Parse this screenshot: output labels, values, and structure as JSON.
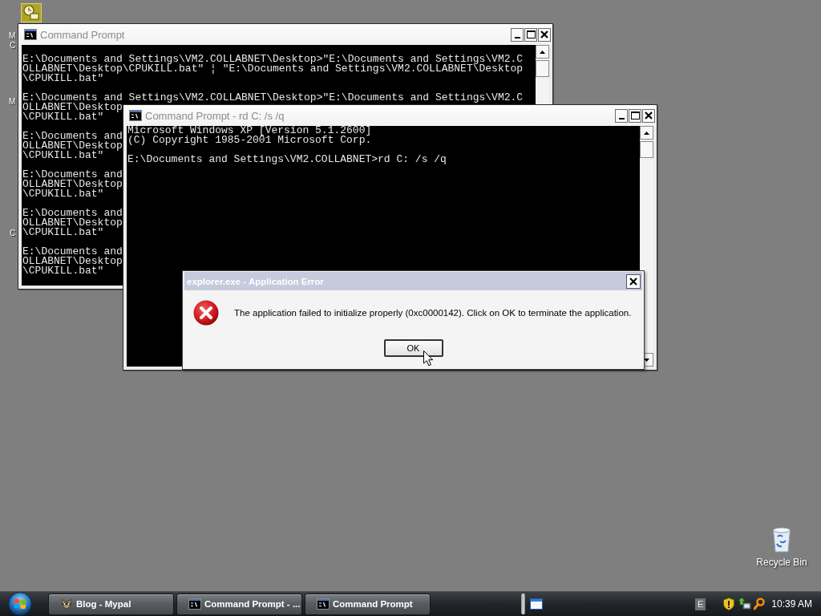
{
  "desktop": {
    "icon_label_fragments": [
      "M",
      "C",
      "M",
      "C"
    ],
    "recycle_bin": {
      "label": "Recycle Bin"
    }
  },
  "windows": [
    {
      "title": "Command Prompt",
      "active": false,
      "blocks": [
        [
          "E:\\Documents and Settings\\VM2.COLLABNET\\Desktop>\"E:\\Documents and Settings\\VM2.C",
          "OLLABNET\\Desktop\\CPUKILL.bat\" ¦ \"E:\\Documents and Settings\\VM2.COLLABNET\\Desktop",
          "\\CPUKILL.bat\""
        ],
        [
          "E:\\Documents and Settings\\VM2.COLLABNET\\Desktop>\"E:\\Documents and Settings\\VM2.C",
          "OLLABNET\\Desktop",
          "\\CPUKILL.bat\""
        ],
        [
          "E:\\Documents and",
          "OLLABNET\\Desktop",
          "\\CPUKILL.bat\""
        ],
        [
          "E:\\Documents and",
          "OLLABNET\\Desktop",
          "\\CPUKILL.bat\""
        ],
        [
          "E:\\Documents and",
          "OLLABNET\\Desktop",
          "\\CPUKILL.bat\""
        ],
        [
          "E:\\Documents and",
          "OLLABNET\\Desktop",
          "\\CPUKILL.bat\""
        ]
      ]
    },
    {
      "title": "Command Prompt - rd C: /s /q",
      "active": false,
      "blocks": [
        [
          "Microsoft Windows XP [Version 5.1.2600]",
          "(C) Copyright 1985-2001 Microsoft Corp."
        ],
        [
          "E:\\Documents and Settings\\VM2.COLLABNET>rd C: /s /q"
        ]
      ]
    }
  ],
  "dialog": {
    "title": "explorer.exe - Application Error",
    "message": "The application failed to initialize properly (0xc0000142). Click on OK to terminate the application.",
    "button": "OK"
  },
  "taskbar": {
    "buttons": [
      {
        "label": "Blog - Mypal",
        "kind": "browser",
        "selected": false
      },
      {
        "label": "Command Prompt - ...",
        "kind": "console",
        "selected": false
      },
      {
        "label": "Command Prompt",
        "kind": "console",
        "selected": false
      }
    ],
    "language": "E",
    "clock": "10:39 AM"
  }
}
